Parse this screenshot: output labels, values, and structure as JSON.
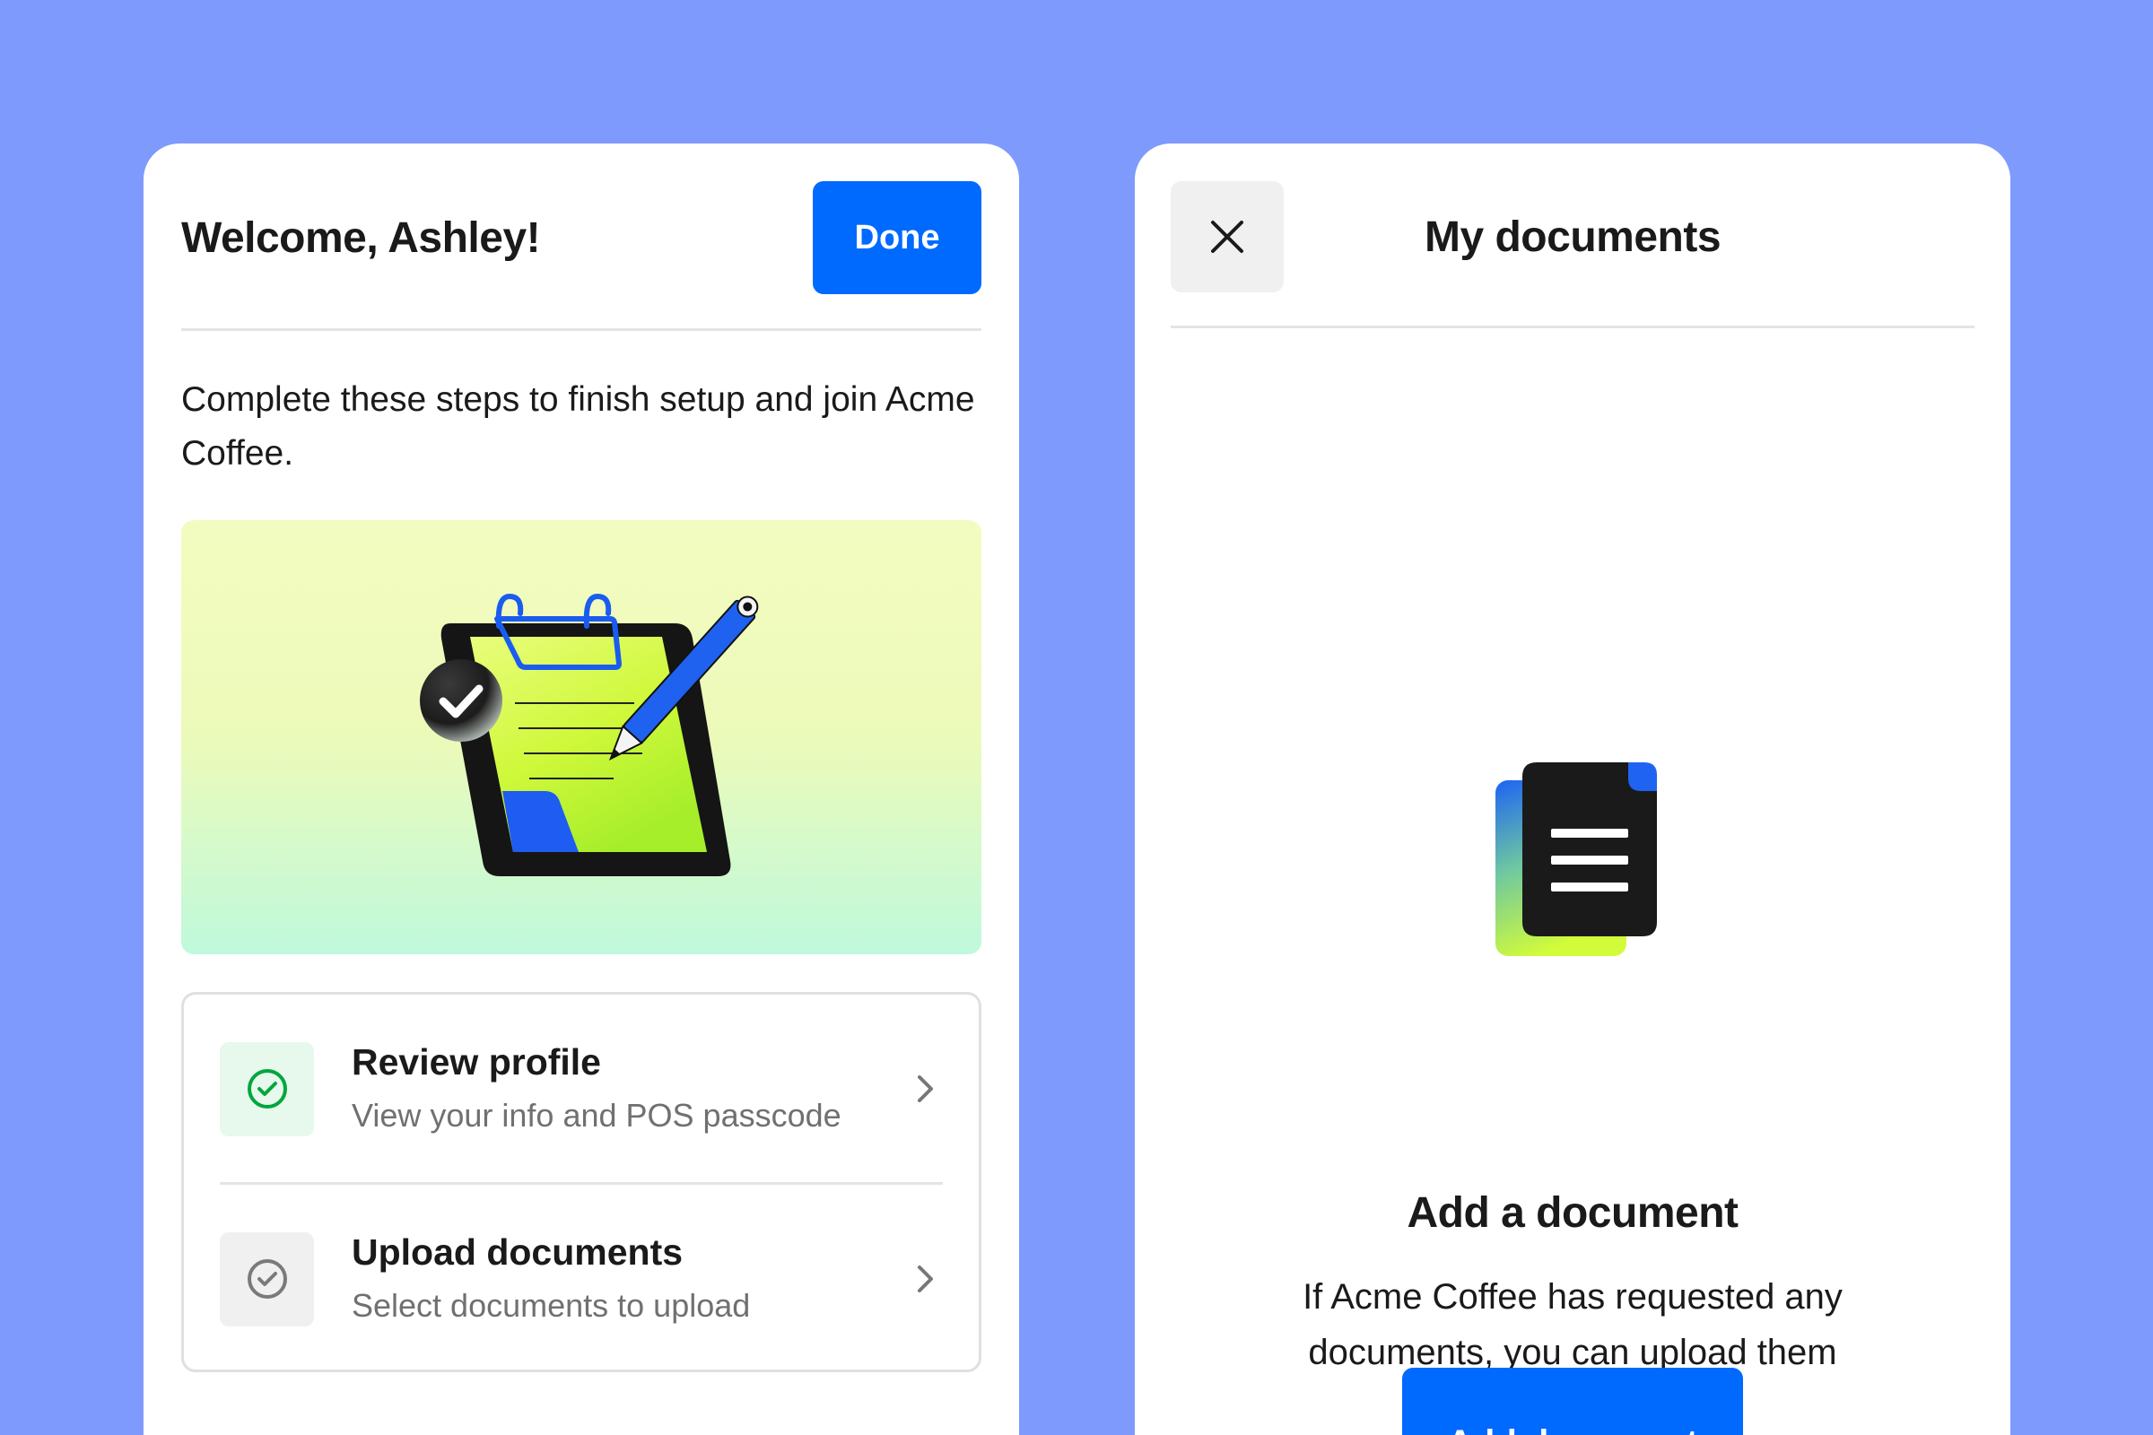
{
  "welcome_panel": {
    "title": "Welcome, Ashley!",
    "done_label": "Done",
    "intro": "Complete these steps to finish setup and join Acme Coffee.",
    "steps": [
      {
        "title": "Review profile",
        "subtitle": "View your info and POS passcode",
        "status": "complete"
      },
      {
        "title": "Upload documents",
        "subtitle": "Select documents to upload",
        "status": "incomplete"
      }
    ]
  },
  "documents_panel": {
    "title": "My documents",
    "empty_heading": "Add a document",
    "empty_body": "If Acme Coffee has requested any documents, you can upload them here.",
    "add_label": "Add document"
  },
  "colors": {
    "background": "#7f9afd",
    "primary": "#006aff",
    "success": "#00a63e",
    "illustration_lime": "#d4fc3a"
  },
  "icons": {
    "close": "close-icon",
    "chevron": "chevron-right-icon",
    "check_complete": "check-circle-icon",
    "check_incomplete": "check-circle-outline-icon",
    "document": "document-icon",
    "illustration": "clipboard-illustration"
  }
}
